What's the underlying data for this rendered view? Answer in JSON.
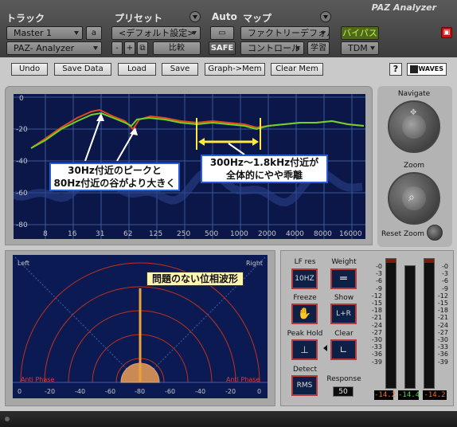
{
  "header": {
    "track_title": "トラック",
    "preset_title": "プリセット",
    "auto_title": "Auto",
    "map_title": "マップ",
    "track_name": "Master 1",
    "track_channel": "a",
    "plugin_name": "PAZ- Analyzer",
    "preset_value": "<デフォルト設定>",
    "preset_minus": "-",
    "preset_plus": "+",
    "compare_label": "比較",
    "safe_label": "SAFE",
    "map_value": "ファクトリーデフォル",
    "controller_value": "コントロール",
    "learn_label": "学習",
    "bypass_label": "バイパス",
    "tdm_label": "TDM"
  },
  "toolbar": {
    "undo": "Undo",
    "save_data": "Save Data",
    "load": "Load",
    "save": "Save",
    "graph_mem": "Graph->Mem",
    "clear_mem": "Clear Mem",
    "help": "?",
    "logo": "WAVES"
  },
  "spectrum": {
    "y_ticks": [
      "0",
      "-20",
      "-40",
      "-60",
      "-80"
    ],
    "x_ticks": [
      "8",
      "16",
      "31",
      "62",
      "125",
      "250",
      "500",
      "1000",
      "2000",
      "4000",
      "8000",
      "16000"
    ],
    "colors": {
      "current": "#e24a1c",
      "memory": "#6fd12a"
    },
    "annotation_peak": "30Hz付近のピークと\n80Hz付近の谷がより大きく",
    "annotation_range": "300Hz〜1.8kHz付近が\n全体的にやや乖離"
  },
  "navigate": {
    "label": "Navigate",
    "zoom_label": "Zoom",
    "reset_label": "Reset Zoom"
  },
  "phase": {
    "left_label": "Left",
    "right_label": "Right",
    "anti_left": "Anti Phase",
    "anti_right": "Anti Phase",
    "x_ticks": [
      "0",
      "-20",
      "-40",
      "-60",
      "-80",
      "-60",
      "-40",
      "-20",
      "0"
    ],
    "annotation": "問題のない位相波形"
  },
  "controls": {
    "lf_res_label": "LF res",
    "lf_res_value": "10HZ",
    "weight_label": "Weight",
    "freeze_label": "Freeze",
    "show_label": "Show",
    "show_value": "L+R",
    "peak_hold_label": "Peak Hold",
    "clear_label": "Clear",
    "detect_label": "Detect",
    "detect_value": "RMS",
    "response_label": "Response",
    "response_value": "50"
  },
  "meters": {
    "scale": [
      "-0",
      "-3",
      "-6",
      "-9",
      "-12",
      "-15",
      "-18",
      "-21",
      "-24",
      "-27",
      "-30",
      "-33",
      "-36",
      "-39"
    ],
    "left_readout": "-14.2",
    "mid_readout": "-14.4",
    "right_readout": "-14.2"
  },
  "footer": {
    "plugin_label": "PAZ Analyzer"
  }
}
